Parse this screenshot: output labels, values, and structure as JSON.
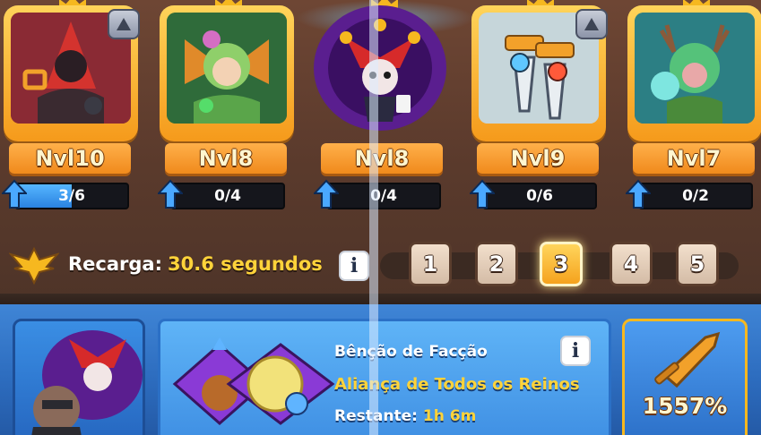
{
  "cards": [
    {
      "level": "Nvl10",
      "progress": "3/6",
      "progress_fraction": 0.5,
      "has_upgrade_badge": true
    },
    {
      "level": "Nvl8",
      "progress": "0/4",
      "progress_fraction": 0,
      "has_upgrade_badge": false
    },
    {
      "level": "Nvl8",
      "progress": "0/4",
      "progress_fraction": 0,
      "has_upgrade_badge": false
    },
    {
      "level": "Nvl9",
      "progress": "0/6",
      "progress_fraction": 0,
      "has_upgrade_badge": true
    },
    {
      "level": "Nvl7",
      "progress": "0/2",
      "progress_fraction": 0,
      "has_upgrade_badge": false
    }
  ],
  "cooldown": {
    "label": "Recarga:",
    "value": "30.6 segundos",
    "info_glyph": "i"
  },
  "slots": {
    "numbers": [
      "1",
      "2",
      "3",
      "4",
      "5"
    ],
    "active": "3"
  },
  "blessing": {
    "title": "Bênção de Facção",
    "faction": "Aliança de Todos os Reinos",
    "remaining_label": "Restante:",
    "remaining_value": "1h 6m",
    "info_glyph": "i"
  },
  "power": {
    "percent": "1557%"
  },
  "colors": {
    "gold": "#f6b81f",
    "yellow_text": "#ffd33a",
    "progress_blue": "#2a82e0",
    "panel_blue": "#3f8fe3"
  }
}
